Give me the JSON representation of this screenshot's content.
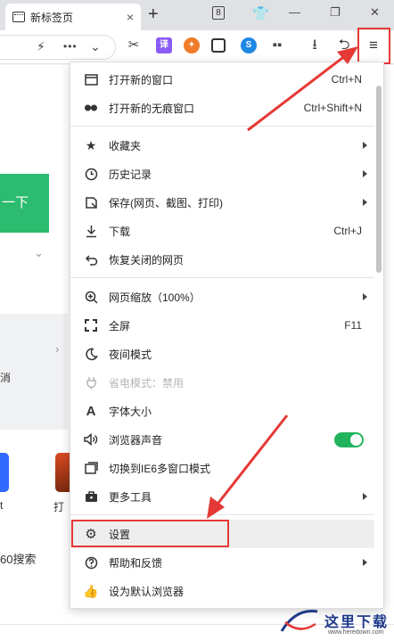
{
  "browser": {
    "tab": {
      "title": "新标签页",
      "close_glyph": "×"
    },
    "new_tab_glyph": "+",
    "tab_count": "8",
    "window_controls": {
      "minimize": "—",
      "restore": "❐",
      "close": "✕"
    },
    "toolbar_icons": [
      "lightning-icon",
      "more-icon",
      "chevron-down-icon",
      "scissors-icon",
      "translate-icon",
      "game-icon",
      "reader-icon",
      "sync-icon",
      "apps-icon",
      "download-icon",
      "undo-icon"
    ],
    "menu_glyph": "≡"
  },
  "background_page": {
    "search_button": "一下",
    "bottom_left_text": "60搜索",
    "tile_left_text": "t",
    "tile_right_text": "打",
    "side_char": "消"
  },
  "menu": {
    "items": [
      {
        "id": "new-window",
        "icon": "window-icon",
        "label": "打开新的窗口",
        "shortcut": "Ctrl+N"
      },
      {
        "id": "incognito",
        "icon": "mask-icon",
        "label": "打开新的无痕窗口",
        "shortcut": "Ctrl+Shift+N"
      },
      {
        "id": "favorites",
        "icon": "star-list-icon",
        "label": "收藏夹",
        "submenu": true
      },
      {
        "id": "history",
        "icon": "clock-icon",
        "label": "历史记录",
        "submenu": true
      },
      {
        "id": "save",
        "icon": "save-icon",
        "label": "保存(网页、截图、打印)",
        "submenu": true
      },
      {
        "id": "downloads",
        "icon": "download-icon",
        "label": "下载",
        "shortcut": "Ctrl+J"
      },
      {
        "id": "restore-closed",
        "icon": "undo-icon",
        "label": "恢复关闭的网页"
      },
      {
        "id": "zoom",
        "icon": "zoom-icon",
        "label": "网页缩放（100%）",
        "submenu": true
      },
      {
        "id": "fullscreen",
        "icon": "fullscreen-icon",
        "label": "全屏",
        "shortcut": "F11"
      },
      {
        "id": "night-mode",
        "icon": "moon-icon",
        "label": "夜间模式"
      },
      {
        "id": "power-saving",
        "icon": "plug-icon",
        "label": "省电模式：禁用",
        "disabled": true
      },
      {
        "id": "font-size",
        "icon": "font-icon",
        "label": "字体大小"
      },
      {
        "id": "browser-sound",
        "icon": "speaker-icon",
        "label": "浏览器声音",
        "toggle_on": true
      },
      {
        "id": "ie6-mode",
        "icon": "multi-window-icon",
        "label": "切换到IE6多窗口模式"
      },
      {
        "id": "more-tools",
        "icon": "toolbox-icon",
        "label": "更多工具",
        "submenu": true
      },
      {
        "id": "settings",
        "icon": "gear-icon",
        "label": "设置",
        "highlighted": true
      },
      {
        "id": "help",
        "icon": "help-icon",
        "label": "帮助和反馈",
        "submenu": true
      },
      {
        "id": "default-browser",
        "icon": "thumbs-up-icon",
        "label": "设为默认浏览器"
      }
    ]
  },
  "annotations": {
    "color": "#e53935"
  },
  "watermark": {
    "text": "这里下载",
    "url": "www.heredown.com"
  },
  "colors": {
    "accent_green": "#2dbb6f",
    "toggle_green": "#21b35e",
    "annotation_red": "#e53935"
  }
}
